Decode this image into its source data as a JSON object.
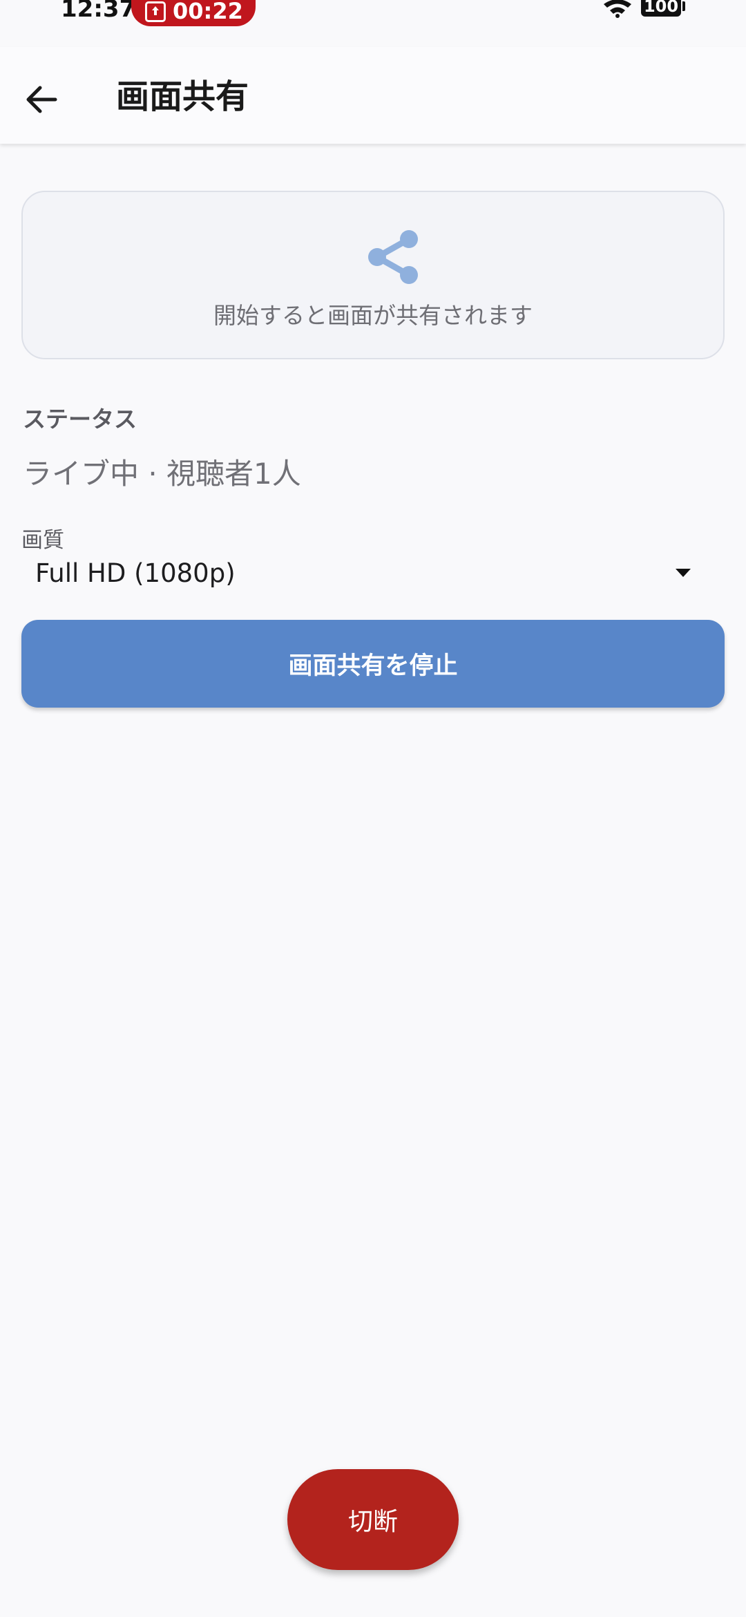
{
  "status_bar": {
    "time": "12:37",
    "recording_timer": "00:22",
    "battery": "100"
  },
  "app_bar": {
    "title": "画面共有"
  },
  "share_card": {
    "caption": "開始すると画面が共有されます"
  },
  "status": {
    "label": "ステータス",
    "value": "ライブ中 · 視聴者1人"
  },
  "quality": {
    "label": "画質",
    "selected": "Full HD (1080p)"
  },
  "buttons": {
    "stop_sharing": "画面共有を停止",
    "disconnect": "切断"
  },
  "colors": {
    "primary": "#5886c9",
    "danger": "#b3231d",
    "recording": "#c0161d"
  }
}
